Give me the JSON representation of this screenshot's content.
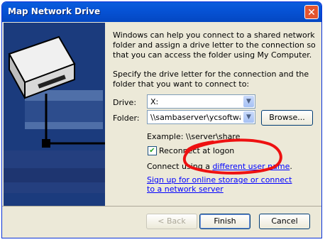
{
  "window": {
    "title": "Map Network Drive",
    "close_glyph": "✕"
  },
  "intro_text": "Windows can help you connect to a shared network folder and assign a drive letter to the connection so that you can access the folder using My Computer.",
  "spec_text": "Specify the drive letter for the connection and the folder that you want to connect to:",
  "drive": {
    "label": "Drive:",
    "value": "X:"
  },
  "folder": {
    "label": "Folder:",
    "value": "\\\\sambaserver\\ycsoftware"
  },
  "browse_label": "Browse...",
  "example_text": "Example: \\\\server\\share",
  "reconnect": {
    "label": "Reconnect at logon",
    "checked": true
  },
  "connect_prefix": "Connect using a ",
  "connect_link": "different user name",
  "connect_suffix": ".",
  "signup_link": "Sign up for online storage or connect to a network server",
  "buttons": {
    "back": "< Back",
    "finish": "Finish",
    "cancel": "Cancel"
  },
  "colors": {
    "title_bar": "#0653d6",
    "side_panel": "#1b3b7d",
    "annotation": "#ee1111",
    "link": "#0000ff"
  },
  "icons": [
    "close-icon",
    "network-drive-icon",
    "dropdown-arrow-icon",
    "checkmark-icon"
  ]
}
